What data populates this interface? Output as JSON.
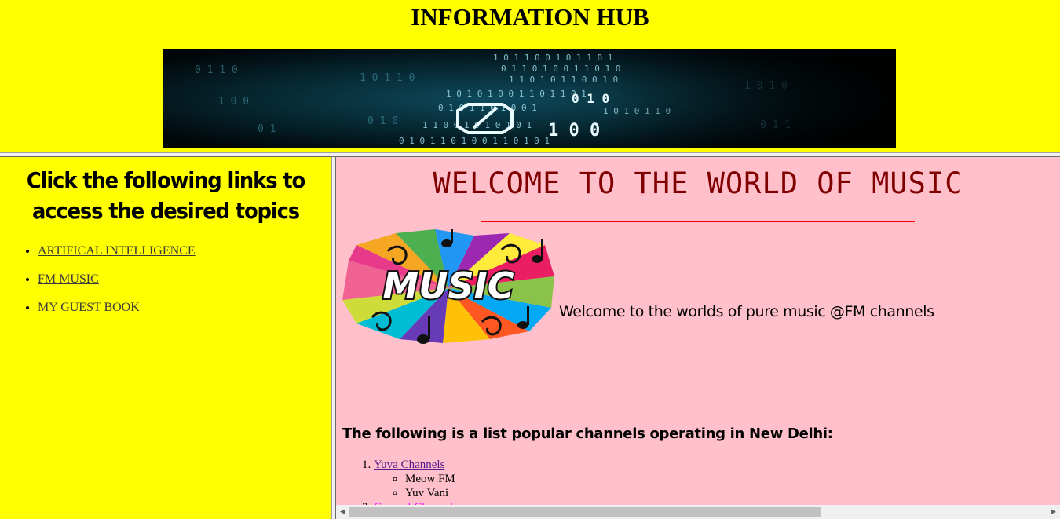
{
  "top_frame": {
    "title": "INFORMATION HUB",
    "banner_icon": "binary-code-banner-image"
  },
  "left_frame": {
    "heading": "Click the following links to access the desired topics",
    "links": [
      {
        "label": "ARTIFICAL INTELLIGENCE"
      },
      {
        "label": "FM MUSIC"
      },
      {
        "label": "MY GUEST BOOK"
      }
    ]
  },
  "right_frame": {
    "title": "WELCOME TO THE WORLD OF MUSIC",
    "logo_text": "MUSIC",
    "welcome_text": "Welcome to the worlds of pure music @FM channels",
    "channels_heading": "The following is a list popular channels operating in New Delhi:",
    "channels": [
      {
        "label": "Yuva Channels",
        "items": [
          "Meow FM",
          "Yuv Vani"
        ]
      },
      {
        "label": "General Channels",
        "items": []
      }
    ]
  },
  "colors": {
    "background_yellow": "#ffff00",
    "content_pink": "#ffc0cb",
    "title_maroon": "#800000",
    "rule_red": "#ff0000"
  },
  "scrollbar": {
    "left_arrow_icon": "chevron-left-icon",
    "right_arrow_icon": "chevron-right-icon"
  }
}
